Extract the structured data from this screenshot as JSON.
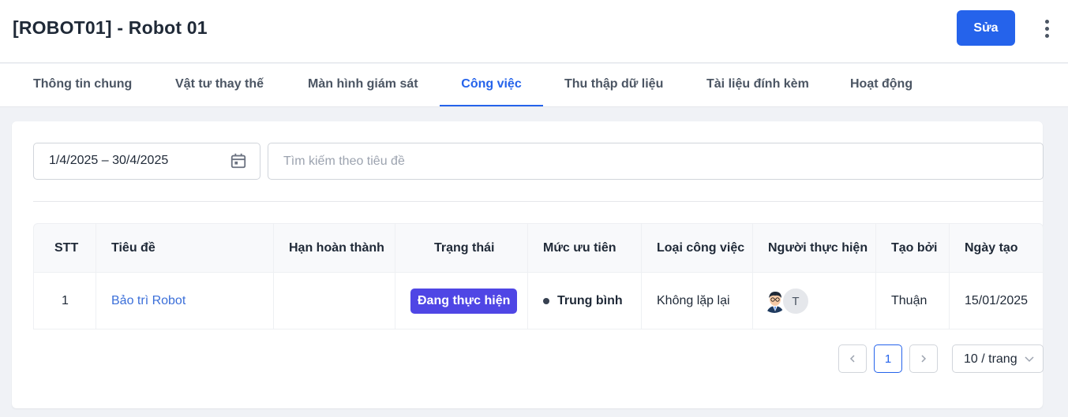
{
  "header": {
    "title": "[ROBOT01] - Robot 01",
    "edit_label": "Sửa",
    "more_icon": "more-vertical-icon",
    "accent": "#2563eb"
  },
  "tabs": [
    {
      "label": "Thông tin chung",
      "active": false
    },
    {
      "label": "Vật tư thay thế",
      "active": false
    },
    {
      "label": "Màn hình giám sát",
      "active": false
    },
    {
      "label": "Công việc",
      "active": true
    },
    {
      "label": "Thu thập dữ liệu",
      "active": false
    },
    {
      "label": "Tài liệu đính kèm",
      "active": false
    },
    {
      "label": "Hoạt động",
      "active": false
    }
  ],
  "filters": {
    "date_range": "1/4/2025 – 30/4/2025",
    "date_icon": "calendar-icon",
    "search_placeholder": "Tìm kiếm theo tiêu đề",
    "search_value": ""
  },
  "table": {
    "columns": [
      "STT",
      "Tiêu đề",
      "Hạn hoàn thành",
      "Trạng thái",
      "Mức ưu tiên",
      "Loại công việc",
      "Người thực hiện",
      "Tạo bởi",
      "Ngày tạo"
    ],
    "rows": [
      {
        "stt": "1",
        "title": "Bảo trì Robot",
        "due": "",
        "status": "Đang thực hiện",
        "status_color": "#4f46e5",
        "priority": "Trung bình",
        "type": "Không lặp lại",
        "assignee_avatar_icon": "user-avatar-icon",
        "assignee_initial": "T",
        "created_by": "Thuận",
        "created_at": "15/01/2025"
      }
    ]
  },
  "pagination": {
    "current_page": "1",
    "page_size": "10 / trang"
  }
}
